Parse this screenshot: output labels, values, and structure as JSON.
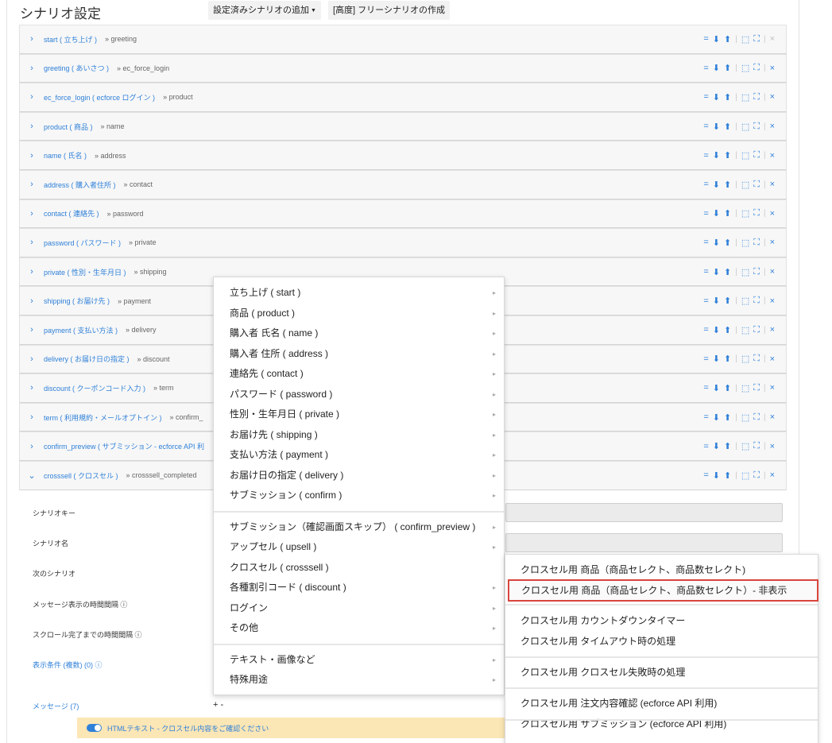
{
  "page": {
    "title": "シナリオ設定",
    "add_preset_button": "設定済みシナリオの追加",
    "create_free_button": "[高度] フリーシナリオの作成"
  },
  "actions": {
    "collapse": "=",
    "move_down": "⬇",
    "move_up": "⬆",
    "sep": "|",
    "shrink": "⬚",
    "expand": "⛶",
    "delete": "×"
  },
  "scenarios": [
    {
      "name": "start ( 立ち上げ )",
      "next": "» greeting",
      "deletable": false
    },
    {
      "name": "greeting ( あいさつ )",
      "next": "» ec_force_login",
      "deletable": true
    },
    {
      "name": "ec_force_login ( ecforce ログイン )",
      "next": "» product",
      "deletable": true
    },
    {
      "name": "product ( 商品 )",
      "next": "» name",
      "deletable": true
    },
    {
      "name": "name ( 氏名 )",
      "next": "» address",
      "deletable": true
    },
    {
      "name": "address ( 購入者住所 )",
      "next": "» contact",
      "deletable": true
    },
    {
      "name": "contact ( 連絡先 )",
      "next": "» password",
      "deletable": true
    },
    {
      "name": "password ( パスワード )",
      "next": "» private",
      "deletable": true
    },
    {
      "name": "private ( 性別・生年月日 )",
      "next": "» shipping",
      "deletable": true
    },
    {
      "name": "shipping ( お届け先 )",
      "next": "» payment",
      "deletable": true
    },
    {
      "name": "payment ( 支払い方法 )",
      "next": "» delivery",
      "deletable": true
    },
    {
      "name": "delivery ( お届け日の指定 )",
      "next": "» discount",
      "deletable": true
    },
    {
      "name": "discount ( クーポンコード入力 )",
      "next": "» term",
      "deletable": true
    },
    {
      "name": "term ( 利用規約・メールオプトイン )",
      "next": "» confirm_",
      "deletable": true
    },
    {
      "name": "confirm_preview ( サブミッション - ecforce API 利",
      "next": "",
      "deletable": true
    },
    {
      "name": "crosssell ( クロスセル )",
      "next": "» crosssell_completed",
      "deletable": true,
      "open": true
    }
  ],
  "detail": {
    "scenario_key_label": "シナリオキー",
    "scenario_name_label": "シナリオ名",
    "next_scenario_label": "次のシナリオ",
    "message_interval_label": "メッセージ表示の時間間隔 ⓘ",
    "scroll_interval_label": "スクロール完了までの時間間隔 ⓘ",
    "display_conditions_label": "表示条件 (複数) (0) ⓘ",
    "messages_label": "メッセージ (7)",
    "plus_minus": "+ -",
    "message_item_text": "HTMLテキスト - クロスセル内容をご確認ください"
  },
  "menu": {
    "group1": [
      "立ち上げ ( start )",
      "商品 ( product )",
      "購入者 氏名 ( name )",
      "購入者 住所 ( address )",
      "連絡先 ( contact )",
      "パスワード ( password )",
      "性別・生年月日 ( private )",
      "お届け先 ( shipping )",
      "支払い方法 ( payment )",
      "お届け日の指定 ( delivery )",
      "サブミッション ( confirm )"
    ],
    "group2": [
      "サブミッション（確認画面スキップ） ( confirm_preview )",
      "アップセル ( upsell )",
      "クロスセル ( crosssell )",
      "各種割引コード ( discount )",
      "ログイン",
      "その他"
    ],
    "group3": [
      "テキスト・画像など",
      "特殊用途"
    ],
    "arrow": "▸"
  },
  "submenu": {
    "items": [
      "クロスセル用 商品（商品セレクト、商品数セレクト)",
      "クロスセル用 商品（商品セレクト、商品数セレクト）- 非表示",
      "クロスセル用 カウントダウンタイマー",
      "クロスセル用 タイムアウト時の処理",
      "クロスセル用 クロスセル失敗時の処理",
      "クロスセル用 注文内容確認 (ecforce API 利用)",
      "クロスセル用 サブミッション (ecforce API 利用)"
    ],
    "highlighted_index": 1
  },
  "colors": {
    "accent": "#2f80d9",
    "highlight_border": "#d9453d",
    "message_bg": "#fbe6b5"
  }
}
